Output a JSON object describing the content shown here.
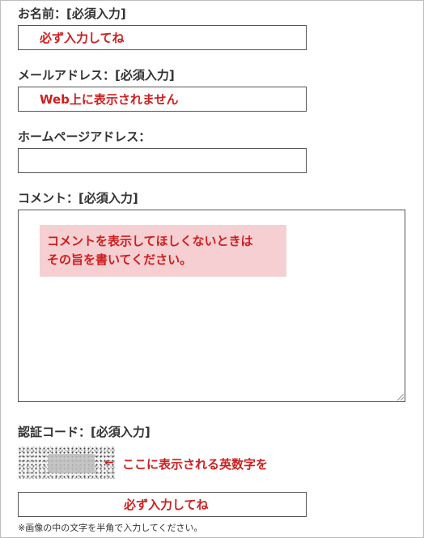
{
  "form": {
    "name": {
      "label": "お名前：[必須入力]",
      "value": "必ず入力してね"
    },
    "email": {
      "label": "メールアドレス：[必須入力]",
      "value": "Web上に表示されません"
    },
    "homepage": {
      "label": "ホームページアドレス：",
      "value": ""
    },
    "comment": {
      "label": "コメント：[必須入力]",
      "note_lines": [
        "コメントを表示してほしくないときは",
        "その旨を書いてください。"
      ]
    },
    "captcha": {
      "label": "認証コード：[必須入力]",
      "arrow": "←",
      "hint": "ここに表示される英数字を",
      "value": "必ず入力してね",
      "footnote": "※画像の中の文字を半角で入力してください。"
    }
  },
  "colors": {
    "accent_red": "#cc1f1f",
    "note_background": "#f6cfd2",
    "label_text": "#333333",
    "field_border": "#555555"
  }
}
